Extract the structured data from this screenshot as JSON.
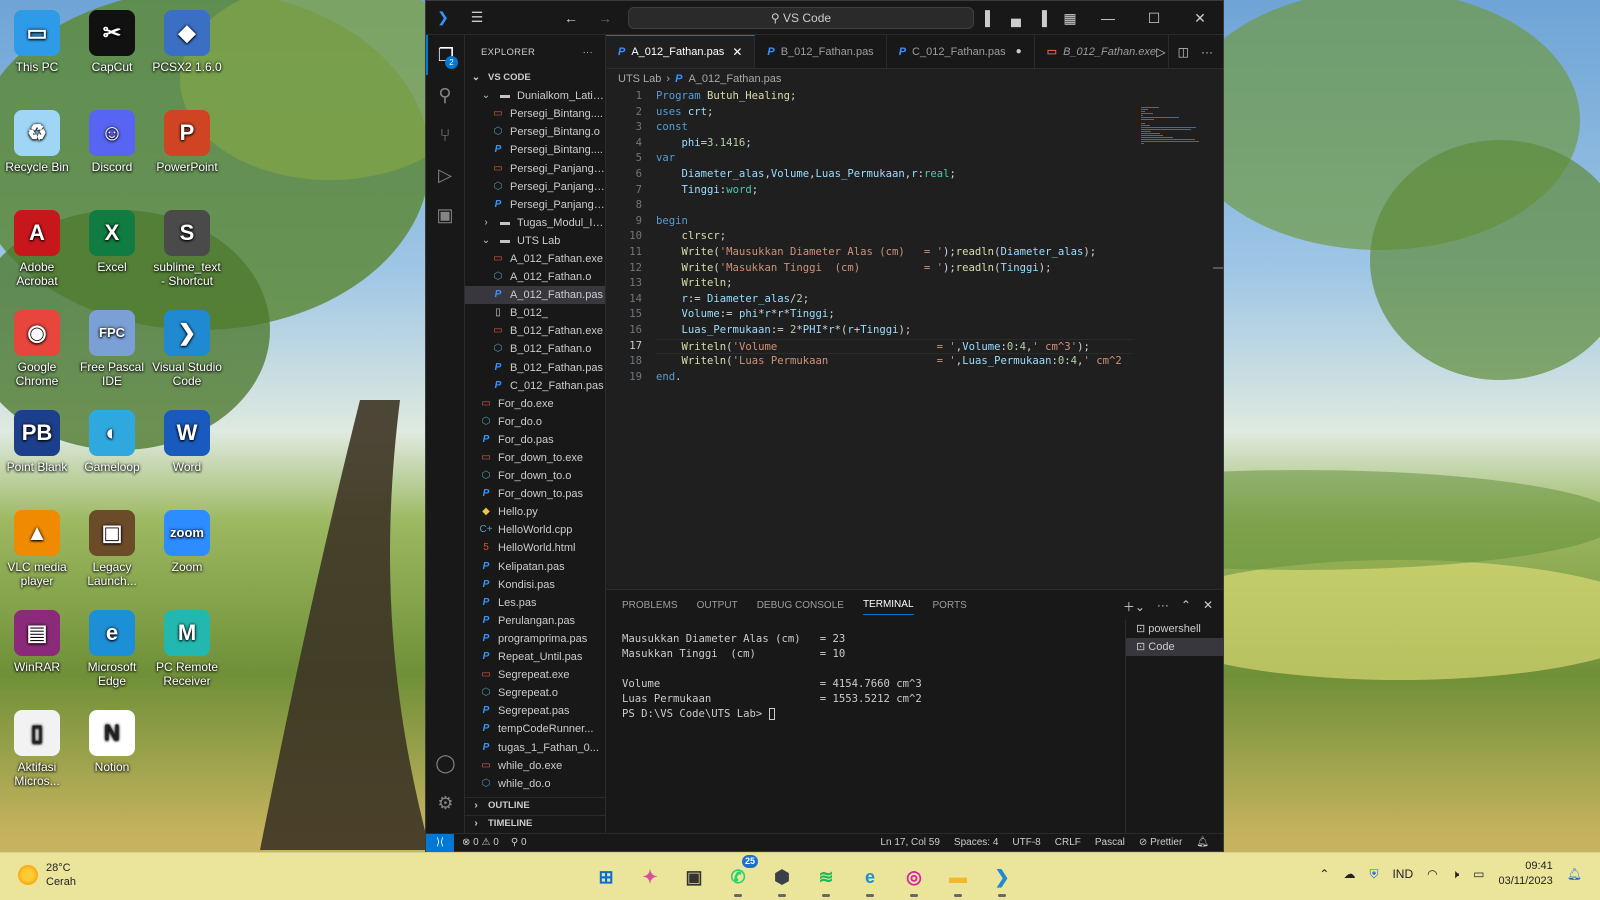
{
  "desktop": {
    "icons": [
      {
        "label": "This PC",
        "color": "#2d9be8",
        "glyph": "▭"
      },
      {
        "label": "CapCut",
        "color": "#111111",
        "glyph": "✂"
      },
      {
        "label": "PCSX2 1.6.0",
        "color": "#3b6fc4",
        "glyph": "◆"
      },
      {
        "label": "Recycle Bin",
        "color": "#9fd6f5",
        "glyph": "♻"
      },
      {
        "label": "Discord",
        "color": "#5865f2",
        "glyph": "☺"
      },
      {
        "label": "PowerPoint",
        "color": "#d04423",
        "glyph": "P"
      },
      {
        "label": "Adobe Acrobat",
        "color": "#c8161d",
        "glyph": "A"
      },
      {
        "label": "Excel",
        "color": "#107c41",
        "glyph": "X"
      },
      {
        "label": "sublime_text - Shortcut",
        "color": "#4a4a4a",
        "glyph": "S"
      },
      {
        "label": "Google Chrome",
        "color": "#e8453c",
        "glyph": "◉"
      },
      {
        "label": "Free Pascal IDE",
        "color": "#7aa0d6",
        "glyph": "FPC"
      },
      {
        "label": "Visual Studio Code",
        "color": "#1f8ad2",
        "glyph": "❯"
      },
      {
        "label": "Point Blank",
        "color": "#1c3f8c",
        "glyph": "PB"
      },
      {
        "label": "Gameloop",
        "color": "#2fa8e0",
        "glyph": "◐"
      },
      {
        "label": "Word",
        "color": "#185abd",
        "glyph": "W"
      },
      {
        "label": "VLC media player",
        "color": "#f08a00",
        "glyph": "▲"
      },
      {
        "label": "Legacy Launch...",
        "color": "#6b4b2a",
        "glyph": "▣"
      },
      {
        "label": "Zoom",
        "color": "#2d8cff",
        "glyph": "zoom"
      },
      {
        "label": "WinRAR",
        "color": "#8b2a7a",
        "glyph": "▤"
      },
      {
        "label": "Microsoft Edge",
        "color": "#1c8fd6",
        "glyph": "e"
      },
      {
        "label": "PC Remote Receiver",
        "color": "#22b8b0",
        "glyph": "M"
      },
      {
        "label": "Aktifasi Micros...",
        "color": "#f2f2f2",
        "glyph": "▯"
      },
      {
        "label": "Notion",
        "color": "#ffffff",
        "glyph": "N"
      }
    ]
  },
  "vscode": {
    "command_center": "VS Code",
    "explorer": {
      "title": "EXPLORER",
      "root": "VS CODE",
      "items": [
        {
          "label": "Dunialkom_Latihan",
          "type": "folder-open",
          "indent": 1
        },
        {
          "label": "Persegi_Bintang....",
          "type": "exe",
          "indent": 2
        },
        {
          "label": "Persegi_Bintang.o",
          "type": "o",
          "indent": 2
        },
        {
          "label": "Persegi_Bintang....",
          "type": "pas",
          "indent": 2
        },
        {
          "label": "Persegi_Panjang....",
          "type": "exe",
          "indent": 2
        },
        {
          "label": "Persegi_Panjang....",
          "type": "o",
          "indent": 2
        },
        {
          "label": "Persegi_Panjang....",
          "type": "pas",
          "indent": 2
        },
        {
          "label": "Tugas_Modul_II_...",
          "type": "folder",
          "indent": 1
        },
        {
          "label": "UTS Lab",
          "type": "folder-open",
          "indent": 1
        },
        {
          "label": "A_012_Fathan.exe",
          "type": "exe",
          "indent": 2
        },
        {
          "label": "A_012_Fathan.o",
          "type": "o",
          "indent": 2
        },
        {
          "label": "A_012_Fathan.pas",
          "type": "pas",
          "indent": 2,
          "selected": true
        },
        {
          "label": "B_012_",
          "type": "file",
          "indent": 2
        },
        {
          "label": "B_012_Fathan.exe",
          "type": "exe",
          "indent": 2
        },
        {
          "label": "B_012_Fathan.o",
          "type": "o",
          "indent": 2
        },
        {
          "label": "B_012_Fathan.pas",
          "type": "pas",
          "indent": 2
        },
        {
          "label": "C_012_Fathan.pas",
          "type": "pas",
          "indent": 2
        },
        {
          "label": "For_do.exe",
          "type": "exe",
          "indent": 1
        },
        {
          "label": "For_do.o",
          "type": "o",
          "indent": 1
        },
        {
          "label": "For_do.pas",
          "type": "pas",
          "indent": 1
        },
        {
          "label": "For_down_to.exe",
          "type": "exe",
          "indent": 1
        },
        {
          "label": "For_down_to.o",
          "type": "o",
          "indent": 1
        },
        {
          "label": "For_down_to.pas",
          "type": "pas",
          "indent": 1
        },
        {
          "label": "Hello.py",
          "type": "py",
          "indent": 1
        },
        {
          "label": "HelloWorld.cpp",
          "type": "cpp",
          "indent": 1
        },
        {
          "label": "HelloWorld.html",
          "type": "html",
          "indent": 1
        },
        {
          "label": "Kelipatan.pas",
          "type": "pas",
          "indent": 1
        },
        {
          "label": "Kondisi.pas",
          "type": "pas",
          "indent": 1
        },
        {
          "label": "Les.pas",
          "type": "pas",
          "indent": 1
        },
        {
          "label": "Perulangan.pas",
          "type": "pas",
          "indent": 1
        },
        {
          "label": "programprima.pas",
          "type": "pas",
          "indent": 1
        },
        {
          "label": "Repeat_Until.pas",
          "type": "pas",
          "indent": 1
        },
        {
          "label": "Segrepeat.exe",
          "type": "exe",
          "indent": 1
        },
        {
          "label": "Segrepeat.o",
          "type": "o",
          "indent": 1
        },
        {
          "label": "Segrepeat.pas",
          "type": "pas",
          "indent": 1
        },
        {
          "label": "tempCodeRunner...",
          "type": "pas",
          "indent": 1
        },
        {
          "label": "tugas_1_Fathan_0...",
          "type": "pas",
          "indent": 1
        },
        {
          "label": "while_do.exe",
          "type": "exe",
          "indent": 1
        },
        {
          "label": "while_do.o",
          "type": "o",
          "indent": 1
        }
      ],
      "outline": "OUTLINE",
      "timeline": "TIMELINE"
    },
    "tabs": [
      {
        "label": "A_012_Fathan.pas",
        "type": "pas",
        "active": true,
        "close": "✕"
      },
      {
        "label": "B_012_Fathan.pas",
        "type": "pas"
      },
      {
        "label": "C_012_Fathan.pas",
        "type": "pas",
        "dirty": "●"
      },
      {
        "label": "B_012_Fathan.exe",
        "type": "exe",
        "preview": true
      }
    ],
    "breadcrumb": {
      "folder": "UTS Lab",
      "file": "A_012_Fathan.pas"
    },
    "current_line": 17,
    "code": [
      [
        [
          "kw",
          "Program "
        ],
        [
          "fn",
          "Butuh_Healing"
        ],
        [
          "op",
          ";"
        ]
      ],
      [
        [
          "kw",
          "uses "
        ],
        [
          "id",
          "crt"
        ],
        [
          "op",
          ";"
        ]
      ],
      [
        [
          "kw",
          "const"
        ]
      ],
      [
        [
          "op",
          "    "
        ],
        [
          "id",
          "phi"
        ],
        [
          "op",
          "="
        ],
        [
          "num",
          "3.1416"
        ],
        [
          "op",
          ";"
        ]
      ],
      [
        [
          "kw",
          "var"
        ]
      ],
      [
        [
          "op",
          "    "
        ],
        [
          "id",
          "Diameter_alas"
        ],
        [
          "op",
          ","
        ],
        [
          "id",
          "Volume"
        ],
        [
          "op",
          ","
        ],
        [
          "id",
          "Luas_Permukaan"
        ],
        [
          "op",
          ","
        ],
        [
          "id",
          "r"
        ],
        [
          "op",
          ":"
        ],
        [
          "ty",
          "real"
        ],
        [
          "op",
          ";"
        ]
      ],
      [
        [
          "op",
          "    "
        ],
        [
          "id",
          "Tinggi"
        ],
        [
          "op",
          ":"
        ],
        [
          "ty",
          "word"
        ],
        [
          "op",
          ";"
        ]
      ],
      [],
      [
        [
          "kw",
          "begin"
        ]
      ],
      [
        [
          "op",
          "    "
        ],
        [
          "fn",
          "clrscr"
        ],
        [
          "op",
          ";"
        ]
      ],
      [
        [
          "op",
          "    "
        ],
        [
          "fn",
          "Write"
        ],
        [
          "op",
          "("
        ],
        [
          "str",
          "'Mausukkan Diameter Alas (cm)   = '"
        ],
        [
          "op",
          ");"
        ],
        [
          "fn",
          "readln"
        ],
        [
          "op",
          "("
        ],
        [
          "id",
          "Diameter_alas"
        ],
        [
          "op",
          ");"
        ]
      ],
      [
        [
          "op",
          "    "
        ],
        [
          "fn",
          "Write"
        ],
        [
          "op",
          "("
        ],
        [
          "str",
          "'Masukkan Tinggi  (cm)          = '"
        ],
        [
          "op",
          ");"
        ],
        [
          "fn",
          "readln"
        ],
        [
          "op",
          "("
        ],
        [
          "id",
          "Tinggi"
        ],
        [
          "op",
          ");"
        ]
      ],
      [
        [
          "op",
          "    "
        ],
        [
          "fn",
          "Writeln"
        ],
        [
          "op",
          ";"
        ]
      ],
      [
        [
          "op",
          "    "
        ],
        [
          "id",
          "r"
        ],
        [
          "op",
          ":= "
        ],
        [
          "id",
          "Diameter_alas"
        ],
        [
          "op",
          "/"
        ],
        [
          "num",
          "2"
        ],
        [
          "op",
          ";"
        ]
      ],
      [
        [
          "op",
          "    "
        ],
        [
          "id",
          "Volume"
        ],
        [
          "op",
          ":= "
        ],
        [
          "id",
          "phi"
        ],
        [
          "op",
          "*"
        ],
        [
          "id",
          "r"
        ],
        [
          "op",
          "*"
        ],
        [
          "id",
          "r"
        ],
        [
          "op",
          "*"
        ],
        [
          "id",
          "Tinggi"
        ],
        [
          "op",
          ";"
        ]
      ],
      [
        [
          "op",
          "    "
        ],
        [
          "id",
          "Luas_Permukaan"
        ],
        [
          "op",
          ":= "
        ],
        [
          "num",
          "2"
        ],
        [
          "op",
          "*"
        ],
        [
          "id",
          "PHI"
        ],
        [
          "op",
          "*"
        ],
        [
          "id",
          "r"
        ],
        [
          "op",
          "*("
        ],
        [
          "id",
          "r"
        ],
        [
          "op",
          "+"
        ],
        [
          "id",
          "Tinggi"
        ],
        [
          "op",
          ");"
        ]
      ],
      [
        [
          "op",
          "    "
        ],
        [
          "fn",
          "Writeln"
        ],
        [
          "op",
          "("
        ],
        [
          "str",
          "'Volume                         = '"
        ],
        [
          "op",
          ","
        ],
        [
          "id",
          "Volume"
        ],
        [
          "op",
          ":"
        ],
        [
          "num",
          "0"
        ],
        [
          "op",
          ":"
        ],
        [
          "num",
          "4"
        ],
        [
          "op",
          ","
        ],
        [
          "str",
          "' cm^3'"
        ],
        [
          "op",
          ");"
        ]
      ],
      [
        [
          "op",
          "    "
        ],
        [
          "fn",
          "Writeln"
        ],
        [
          "op",
          "("
        ],
        [
          "str",
          "'Luas Permukaan                 = '"
        ],
        [
          "op",
          ","
        ],
        [
          "id",
          "Luas_Permukaan"
        ],
        [
          "op",
          ":"
        ],
        [
          "num",
          "0"
        ],
        [
          "op",
          ":"
        ],
        [
          "num",
          "4"
        ],
        [
          "op",
          ","
        ],
        [
          "str",
          "' cm^2"
        ]
      ],
      [
        [
          "kw",
          "end"
        ],
        [
          "op",
          "."
        ]
      ]
    ],
    "panel": {
      "tabs": [
        "PROBLEMS",
        "OUTPUT",
        "DEBUG CONSOLE",
        "TERMINAL",
        "PORTS"
      ],
      "active_tab": "TERMINAL",
      "terminal_lines": [
        "Mausukkan Diameter Alas (cm)   = 23",
        "Masukkan Tinggi  (cm)          = 10",
        "",
        "Volume                         = 4154.7660 cm^3",
        "Luas Permukaan                 = 1553.5212 cm^2",
        "PS D:\\VS Code\\UTS Lab> "
      ],
      "terminals": [
        "powershell",
        "Code"
      ],
      "active_terminal": "Code"
    },
    "status": {
      "errors": "0",
      "warnings": "0",
      "ports": "0",
      "position": "Ln 17, Col 59",
      "spaces": "Spaces: 4",
      "encoding": "UTF-8",
      "eol": "CRLF",
      "language": "Pascal",
      "formatter": "Prettier"
    }
  },
  "taskbar": {
    "weather_temp": "28°C",
    "weather_desc": "Cerah",
    "apps": [
      {
        "name": "start-icon",
        "glyph": "⊞",
        "color": "#0a6cd8"
      },
      {
        "name": "copilot-icon",
        "glyph": "✦",
        "color": "#d94f9e"
      },
      {
        "name": "task-view-icon",
        "glyph": "▣",
        "color": "#333333"
      },
      {
        "name": "whatsapp-icon",
        "glyph": "✆",
        "color": "#25d366",
        "badge": "25"
      },
      {
        "name": "app-cube-icon",
        "glyph": "⬢",
        "color": "#3a3f4a"
      },
      {
        "name": "spotify-icon",
        "glyph": "≋",
        "color": "#1db954"
      },
      {
        "name": "edge-icon",
        "glyph": "e",
        "color": "#1c8fd6"
      },
      {
        "name": "instagram-icon",
        "glyph": "◎",
        "color": "#d6249f"
      },
      {
        "name": "file-explorer-icon",
        "glyph": "▬",
        "color": "#f2b92b"
      },
      {
        "name": "vscode-icon",
        "glyph": "❯",
        "color": "#1f8ad2"
      }
    ],
    "language": "IND",
    "time": "09:41",
    "date": "03/11/2023"
  }
}
